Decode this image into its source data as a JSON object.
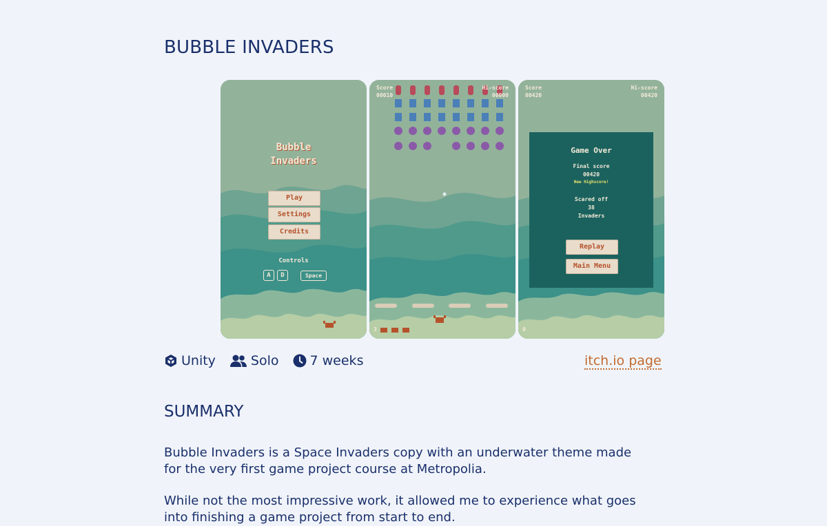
{
  "page": {
    "title": "BUBBLE INVADERS",
    "summary_heading": "SUMMARY",
    "paragraphs": [
      "Bubble Invaders is a Space Invaders copy with an underwater theme made for the very first game project course at Metropolia.",
      "While not the most impressive work, it allowed me to experience what goes into finishing a game project from start to end."
    ]
  },
  "meta": {
    "engine": "Unity",
    "team": "Solo",
    "duration": "7 weeks",
    "link_label": "itch.io page",
    "icons": [
      "unity-icon",
      "users-icon",
      "clock-icon"
    ]
  },
  "screens": {
    "menu": {
      "title_line1": "Bubble",
      "title_line2": "Invaders",
      "buttons": [
        "Play",
        "Settings",
        "Credits"
      ],
      "controls_label": "Controls",
      "keys": [
        "A",
        "D",
        "Space"
      ]
    },
    "gameplay": {
      "score_label": "Score",
      "score_value": "00010",
      "hiscore_label": "Hi-score",
      "hiscore_value": "00000",
      "lives": "3"
    },
    "gameover": {
      "score_label": "Score",
      "score_value": "00420",
      "hiscore_label": "Hi-score",
      "hiscore_value": "00420",
      "heading": "Game Over",
      "final_score_label": "Final score",
      "final_score_value": "00420",
      "new_highscore": "New Highscore!",
      "scared_off_label": "Scared off",
      "scared_off_value": "38",
      "invaders_label": "Invaders",
      "replay": "Replay",
      "main_menu": "Main Menu",
      "lives": "0"
    }
  },
  "colors": {
    "heading": "#1a2f6b",
    "link": "#c26a2e",
    "background": "#f0f4fa",
    "teal_panel": "#1b625e"
  }
}
